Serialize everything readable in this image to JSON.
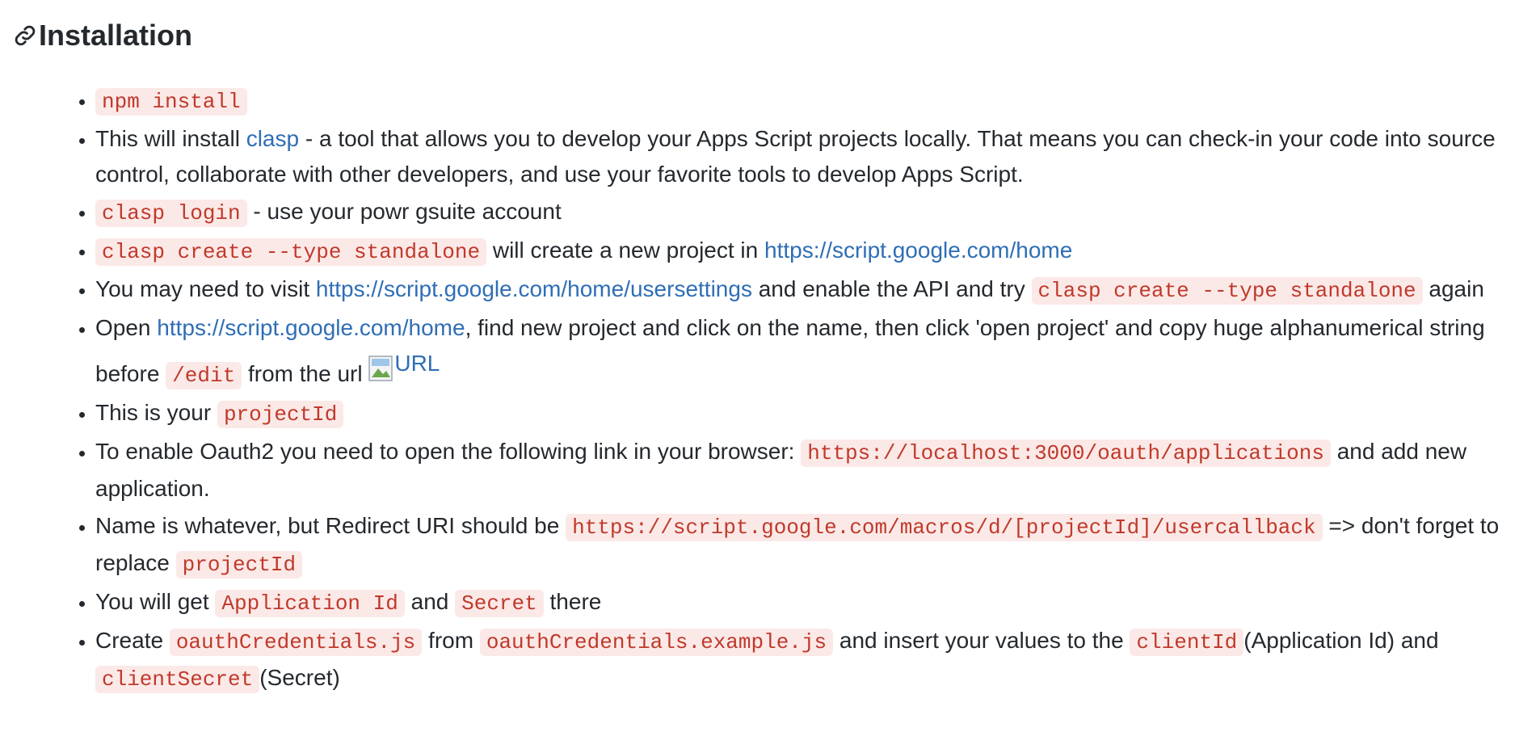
{
  "heading": "Installation",
  "items": {
    "i1": {
      "code1": "npm install"
    },
    "i2": {
      "t1": "This will install ",
      "link1": "clasp",
      "t2": " - a tool that allows you to develop your Apps Script projects locally. That means you can check-in your code into source control, collaborate with other developers, and use your favorite tools to develop Apps Script."
    },
    "i3": {
      "code1": "clasp login",
      "t1": " - use your powr gsuite account"
    },
    "i4": {
      "code1": "clasp create --type standalone",
      "t1": " will create a new project in ",
      "link1": "https://script.google.com/home"
    },
    "i5": {
      "t1": "You may need to visit ",
      "link1": "https://script.google.com/home/usersettings",
      "t2": " and enable the API and try ",
      "code1": "clasp create --type standalone",
      "t3": " again"
    },
    "i6": {
      "t1": "Open ",
      "link1": "https://script.google.com/home",
      "t2": ", find new project and click on the name, then click 'open project' and copy huge alphanumerical string before ",
      "code1": "/edit",
      "t3": " from the url ",
      "img_alt": "URL"
    },
    "i7": {
      "t1": "This is your ",
      "code1": "projectId"
    },
    "i8": {
      "t1": "To enable Oauth2 you need to open the following link in your browser: ",
      "code1": "https://localhost:3000/oauth/applications",
      "t2": " and add new application."
    },
    "i9": {
      "t1": "Name is whatever, but Redirect URI should be ",
      "code1": "https://script.google.com/macros/d/[projectId]/usercallback",
      "t2": " => don't forget to replace ",
      "code2": "projectId"
    },
    "i10": {
      "t1": "You will get ",
      "code1": "Application Id",
      "t2": " and ",
      "code2": "Secret",
      "t3": " there"
    },
    "i11": {
      "t1": "Create ",
      "code1": "oauthCredentials.js",
      "t2": " from ",
      "code2": "oauthCredentials.example.js",
      "t3": " and insert your values to the ",
      "code3": "clientId",
      "t4": "(Application Id) and ",
      "code4": "clientSecret",
      "t5": "(Secret)"
    }
  },
  "colors": {
    "link": "#2f6eb5",
    "code_text": "#c0392b",
    "code_bg": "#fbe9e7",
    "text": "#24292e"
  }
}
